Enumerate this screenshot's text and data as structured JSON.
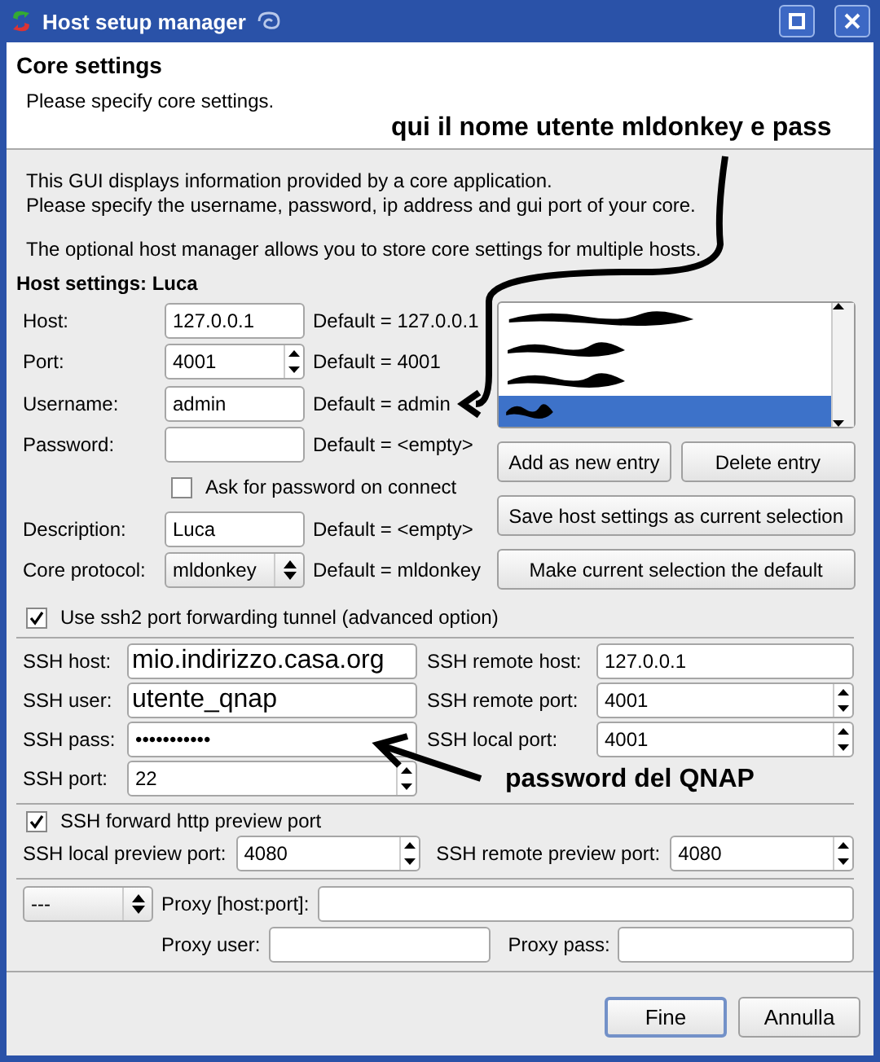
{
  "window": {
    "title": "Host setup manager"
  },
  "header": {
    "title": "Core settings",
    "subtitle": "Please specify core settings."
  },
  "intro": [
    "This GUI displays information provided by a core application.",
    "Please specify the username, password, ip address and gui port of your core.",
    "The optional host manager allows you to store core settings for multiple hosts."
  ],
  "host_settings": {
    "title": "Host settings: Luca",
    "rows": [
      {
        "kind": "text",
        "label": "Host:",
        "value": "127.0.0.1",
        "default": "Default = 127.0.0.1"
      },
      {
        "kind": "spin",
        "label": "Port:",
        "value": "4001",
        "default": "Default = 4001"
      },
      {
        "kind": "text",
        "label": "Username:",
        "value": "admin",
        "default": "Default = admin"
      },
      {
        "kind": "text",
        "label": "Password:",
        "value": "",
        "default": "Default = <empty>"
      },
      {
        "kind": "check",
        "label": "Ask for password on connect",
        "checked": false
      },
      {
        "kind": "text",
        "label": "Description:",
        "value": "Luca",
        "default": "Default = <empty>"
      },
      {
        "kind": "combo",
        "label": "Core protocol:",
        "value": "mldonkey",
        "default": "Default = mldonkey"
      }
    ]
  },
  "host_list": {
    "items": [
      {
        "selected": false
      },
      {
        "selected": false
      },
      {
        "selected": false
      },
      {
        "selected": true
      }
    ]
  },
  "host_buttons": [
    "Add as new entry",
    "Delete entry",
    "Save host settings as current selection",
    "Make current selection the default"
  ],
  "ssh_tunnel": {
    "label": "Use ssh2 port forwarding tunnel (advanced option)",
    "checked": true
  },
  "ssh_fields": [
    {
      "kind": "text",
      "label": "SSH host:",
      "value": "mio.indirizzo.casa.org",
      "large": true
    },
    {
      "kind": "text",
      "label": "SSH remote host:",
      "value": "127.0.0.1",
      "large": false
    },
    {
      "kind": "text",
      "label": "SSH user:",
      "value": "utente_qnap",
      "large": true
    },
    {
      "kind": "spin",
      "label": "SSH remote port:",
      "value": "4001",
      "large": false
    },
    {
      "kind": "text",
      "label": "SSH pass:",
      "value": "•••••••••••",
      "large": false
    },
    {
      "kind": "spin",
      "label": "SSH local port:",
      "value": "4001",
      "large": false
    },
    {
      "kind": "spin",
      "label": "SSH port:",
      "value": "22",
      "large": false
    }
  ],
  "preview": {
    "label": "SSH forward http preview port",
    "checked": true,
    "fields": [
      {
        "label": "SSH local preview port:",
        "value": "4080"
      },
      {
        "label": "SSH remote preview port:",
        "value": "4080"
      }
    ]
  },
  "proxy": {
    "type": "---",
    "host_label": "Proxy [host:port]:",
    "user_label": "Proxy user:",
    "pass_label": "Proxy pass:"
  },
  "buttons": [
    {
      "label": "Fine",
      "default": true
    },
    {
      "label": "Annulla",
      "default": false
    }
  ],
  "annotations": [
    "qui il nome utente mldonkey e pass",
    "password del QNAP"
  ]
}
